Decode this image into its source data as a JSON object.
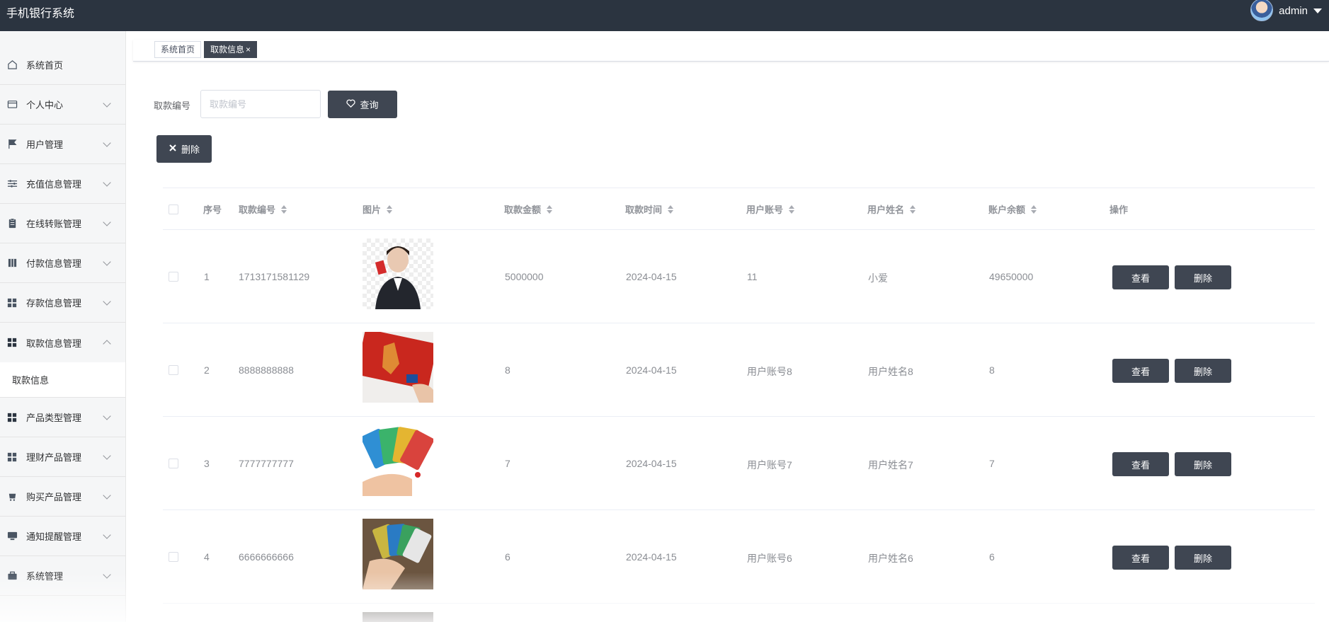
{
  "app": {
    "title": "手机银行系统",
    "user": "admin"
  },
  "sidebar": {
    "items": [
      {
        "label": "系统首页",
        "icon": "home-icon",
        "expandable": false
      },
      {
        "label": "个人中心",
        "icon": "wallet-icon",
        "expandable": true
      },
      {
        "label": "用户管理",
        "icon": "flag-icon",
        "expandable": true
      },
      {
        "label": "充值信息管理",
        "icon": "sliders-icon",
        "expandable": true
      },
      {
        "label": "在线转账管理",
        "icon": "clipboard-icon",
        "expandable": true
      },
      {
        "label": "付款信息管理",
        "icon": "book-icon",
        "expandable": true
      },
      {
        "label": "存款信息管理",
        "icon": "grid-icon",
        "expandable": true
      },
      {
        "label": "取款信息管理",
        "icon": "grid-icon",
        "expandable": true,
        "open": true
      },
      {
        "label": "产品类型管理",
        "icon": "grid-icon",
        "expandable": true
      },
      {
        "label": "理财产品管理",
        "icon": "grid-icon",
        "expandable": true
      },
      {
        "label": "购买产品管理",
        "icon": "cart-icon",
        "expandable": true
      },
      {
        "label": "通知提醒管理",
        "icon": "monitor-icon",
        "expandable": true
      },
      {
        "label": "系统管理",
        "icon": "briefcase-icon",
        "expandable": true
      }
    ],
    "submenu": {
      "label": "取款信息"
    }
  },
  "tabs": [
    {
      "label": "系统首页"
    },
    {
      "label": "取款信息",
      "close": "×"
    }
  ],
  "search": {
    "label": "取款编号",
    "placeholder": "取款编号",
    "value": "",
    "button": "查询"
  },
  "actions": {
    "delete": "删除"
  },
  "table": {
    "headers": {
      "index": "序号",
      "code": "取款编号",
      "image": "图片",
      "amount": "取款金额",
      "time": "取款时间",
      "account": "用户账号",
      "name": "用户姓名",
      "balance": "账户余额",
      "ops": "操作"
    },
    "rows": [
      {
        "index": "1",
        "code": "1713171581129",
        "amount": "5000000",
        "time": "2024-04-15",
        "account": "11",
        "name": "小爱",
        "balance": "49650000",
        "image": "businesswoman-photo"
      },
      {
        "index": "2",
        "code": "8888888888",
        "amount": "8",
        "time": "2024-04-15",
        "account": "用户账号8",
        "name": "用户姓名8",
        "balance": "8",
        "image": "red-card-photo"
      },
      {
        "index": "3",
        "code": "7777777777",
        "amount": "7",
        "time": "2024-04-15",
        "account": "用户账号7",
        "name": "用户姓名7",
        "balance": "7",
        "image": "card-fan-photo"
      },
      {
        "index": "4",
        "code": "6666666666",
        "amount": "6",
        "time": "2024-04-15",
        "account": "用户账号6",
        "name": "用户姓名6",
        "balance": "6",
        "image": "cards-in-hand-photo"
      }
    ],
    "view_label": "查看",
    "delete_label": "删除"
  },
  "colors": {
    "topbar": "#2b3440",
    "button": "#3f4652",
    "sidebar": "#f5f6f7"
  }
}
